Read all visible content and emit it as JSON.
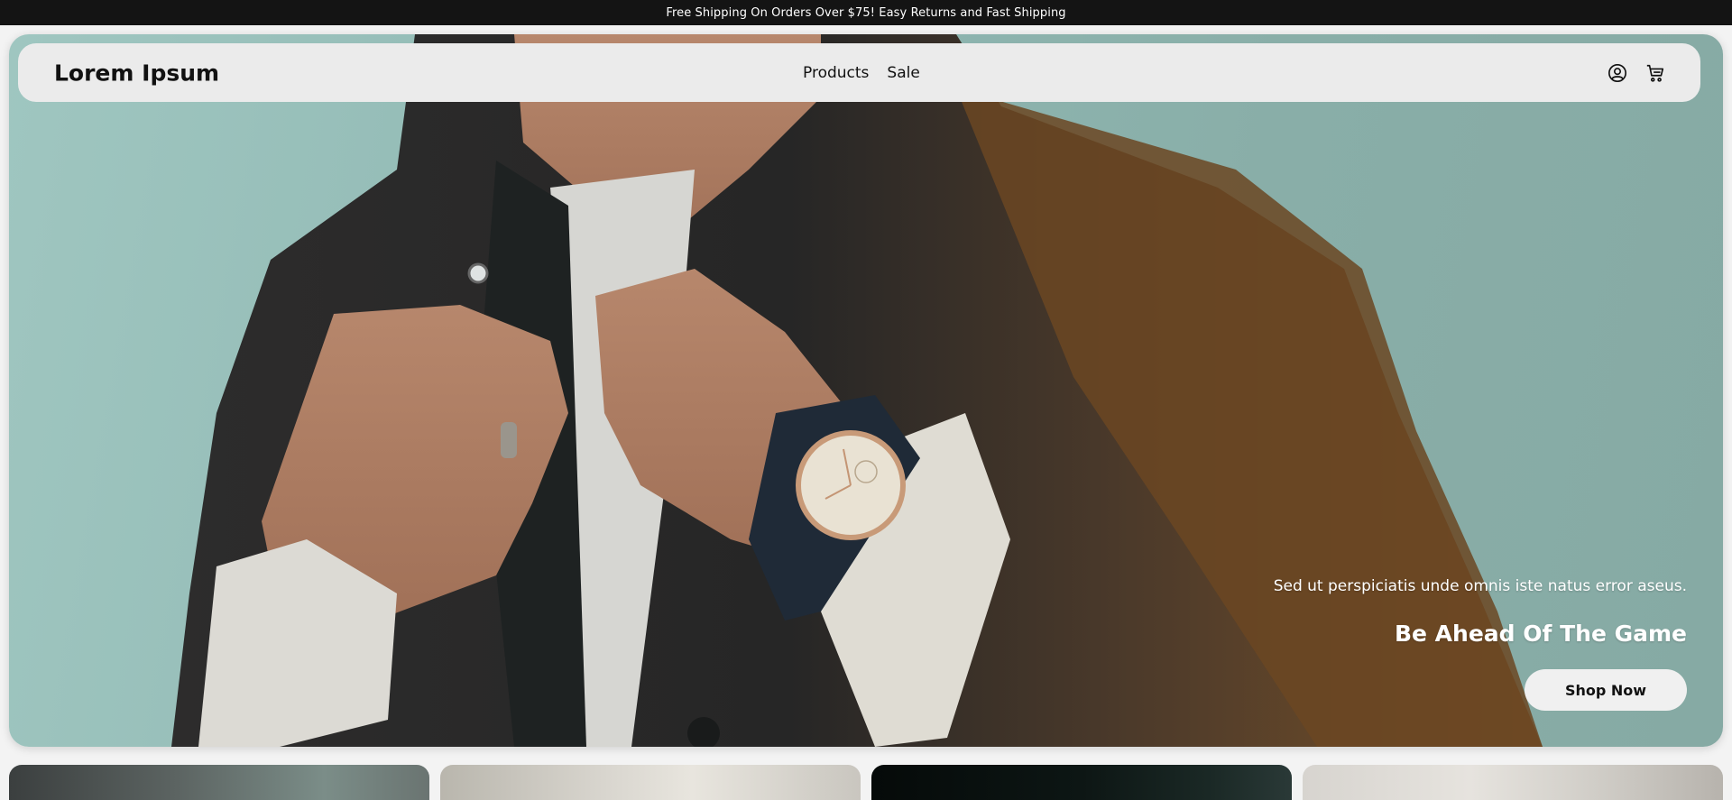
{
  "announcement": {
    "text": "Free Shipping On Orders Over $75! Easy Returns and Fast Shipping"
  },
  "header": {
    "brand": "Lorem Ipsum",
    "nav_links": [
      "Products",
      "Sale"
    ],
    "icons": [
      "account-icon",
      "cart-icon"
    ]
  },
  "hero": {
    "subtitle": "Sed ut perspiciatis unde omnis iste natus error aseus.",
    "title": "Be Ahead Of The Game",
    "cta_label": "Shop Now"
  },
  "colors": {
    "announcement_bg": "#141414",
    "navbar_bg": "#ebebeb",
    "hero_sky": "#9fc6c0",
    "cta_bg": "#f0f0f0"
  }
}
